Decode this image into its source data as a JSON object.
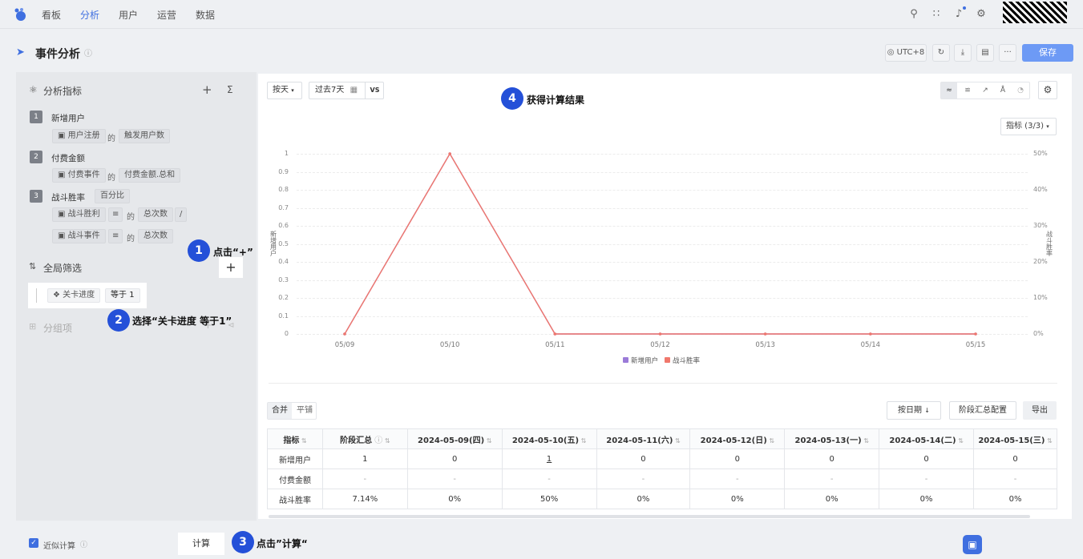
{
  "nav": {
    "items": [
      "看板",
      "分析",
      "用户",
      "运营",
      "数据"
    ],
    "active_index": 1
  },
  "header": {
    "title": "事件分析",
    "timezone": "UTC+8",
    "save_label": "保存"
  },
  "left": {
    "metrics_title": "分析指标",
    "metrics": [
      {
        "num": "1",
        "name": "新增用户",
        "rows": [
          [
            "用户注册",
            "的",
            "触发用户数"
          ]
        ]
      },
      {
        "num": "2",
        "name": "付费金额",
        "rows": [
          [
            "付费事件",
            "的",
            "付费金额.总和"
          ]
        ]
      },
      {
        "num": "3",
        "name": "战斗胜率",
        "tag": "百分比",
        "rows": [
          [
            "战斗胜利",
            "的",
            "总次数",
            "/"
          ],
          [
            "战斗事件",
            "的",
            "总次数"
          ]
        ]
      }
    ],
    "filter_title": "全局筛选",
    "filter": {
      "field": "关卡进度",
      "op": "等于",
      "value": "1"
    },
    "group_title": "分组项",
    "approx_label": "近似计算",
    "calc_label": "计算"
  },
  "toolbar": {
    "granularity": "按天",
    "range": "过去7天",
    "vs": "VS",
    "metric_select": "指标 (3/3)"
  },
  "chart_data": {
    "type": "line",
    "categories": [
      "05/09",
      "05/10",
      "05/11",
      "05/12",
      "05/13",
      "05/14",
      "05/15"
    ],
    "series": [
      {
        "name": "新增用户",
        "values": [
          0,
          1,
          0,
          0,
          0,
          0,
          0
        ],
        "color": "#9b7bd8"
      },
      {
        "name": "战斗胜率",
        "values": [
          0,
          1,
          0,
          0,
          0,
          0,
          0
        ],
        "color": "#f0786c"
      }
    ],
    "ylabel": "新增用户",
    "y2label": "战斗胜率",
    "yticks": [
      "1",
      "0.9",
      "0.8",
      "0.7",
      "0.6",
      "0.5",
      "0.4",
      "0.3",
      "0.2",
      "0.1",
      "0"
    ],
    "y2ticks": [
      "50%",
      "40%",
      "30%",
      "20%",
      "10%",
      "0%"
    ],
    "ylim": [
      0,
      1
    ],
    "legend_position": "bottom"
  },
  "table": {
    "tabs": [
      "合并",
      "平铺"
    ],
    "by_date": "按日期",
    "stage_config": "阶段汇总配置",
    "export": "导出",
    "headers": [
      "指标",
      "阶段汇总",
      "2024-05-09(四)",
      "2024-05-10(五)",
      "2024-05-11(六)",
      "2024-05-12(日)",
      "2024-05-13(一)",
      "2024-05-14(二)",
      "2024-05-15(三)"
    ],
    "rows": [
      [
        "新增用户",
        "1",
        "0",
        "1",
        "0",
        "0",
        "0",
        "0",
        "0"
      ],
      [
        "付费金额",
        "-",
        "-",
        "-",
        "-",
        "-",
        "-",
        "-",
        "-"
      ],
      [
        "战斗胜率",
        "7.14%",
        "0%",
        "50%",
        "0%",
        "0%",
        "0%",
        "0%",
        "0%"
      ]
    ]
  },
  "callouts": [
    {
      "num": "1",
      "text": "点击“+”"
    },
    {
      "num": "2",
      "text": "选择“关卡进度 等于1”"
    },
    {
      "num": "3",
      "text": "点击”计算“"
    },
    {
      "num": "4",
      "text": "获得计算结果"
    }
  ]
}
